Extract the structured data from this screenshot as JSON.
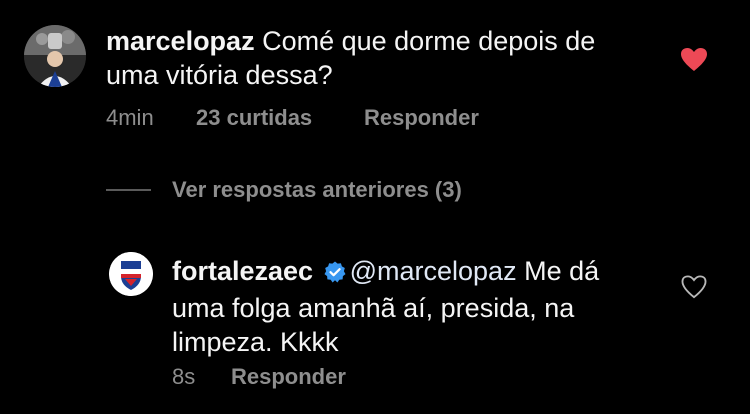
{
  "comment": {
    "username": "marcelopaz",
    "text_line1": "Comé que dorme depois de",
    "text_line2": "uma vitória dessa?",
    "time": "4min",
    "likes": "23 curtidas",
    "reply_label": "Responder",
    "liked": true,
    "heart_color": "#ed4956"
  },
  "view_replies": {
    "label": "Ver respostas anteriores (3)"
  },
  "reply": {
    "username": "fortalezaec",
    "verified": true,
    "mention": "@marcelopaz",
    "text_line1_rest": " Me dá",
    "text_line2": "uma folga amanhã aí, presida, na",
    "text_line3": "limpeza. Kkkk",
    "time": "8s",
    "reply_label": "Responder",
    "liked": false,
    "verified_color": "#3897f0",
    "club_colors": [
      "#1c3f94",
      "#d4232b",
      "#ffffff"
    ]
  }
}
